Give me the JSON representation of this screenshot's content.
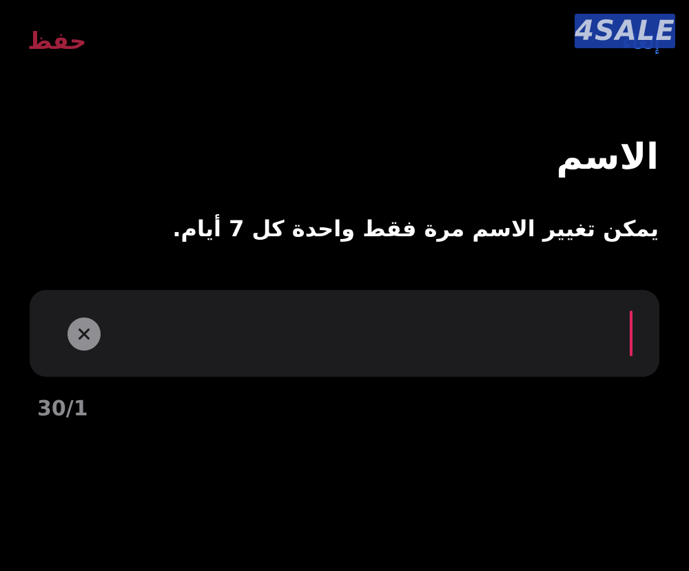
{
  "header": {
    "save_label": "حفظ",
    "cancel_label": "إلغاء",
    "watermark_text": "4SALE"
  },
  "main": {
    "title": "الاسم",
    "subtitle": "يمكن تغيير الاسم مرة فقط واحدة كل 7 أيام.",
    "name_field": {
      "value": "",
      "char_counter": "30/1"
    }
  },
  "colors": {
    "accent": "#e0245e",
    "save": "#a1203c",
    "field_background": "#1c1c1e",
    "clear_button": "#8e8e93"
  },
  "icons": {
    "clear": "close-icon"
  }
}
